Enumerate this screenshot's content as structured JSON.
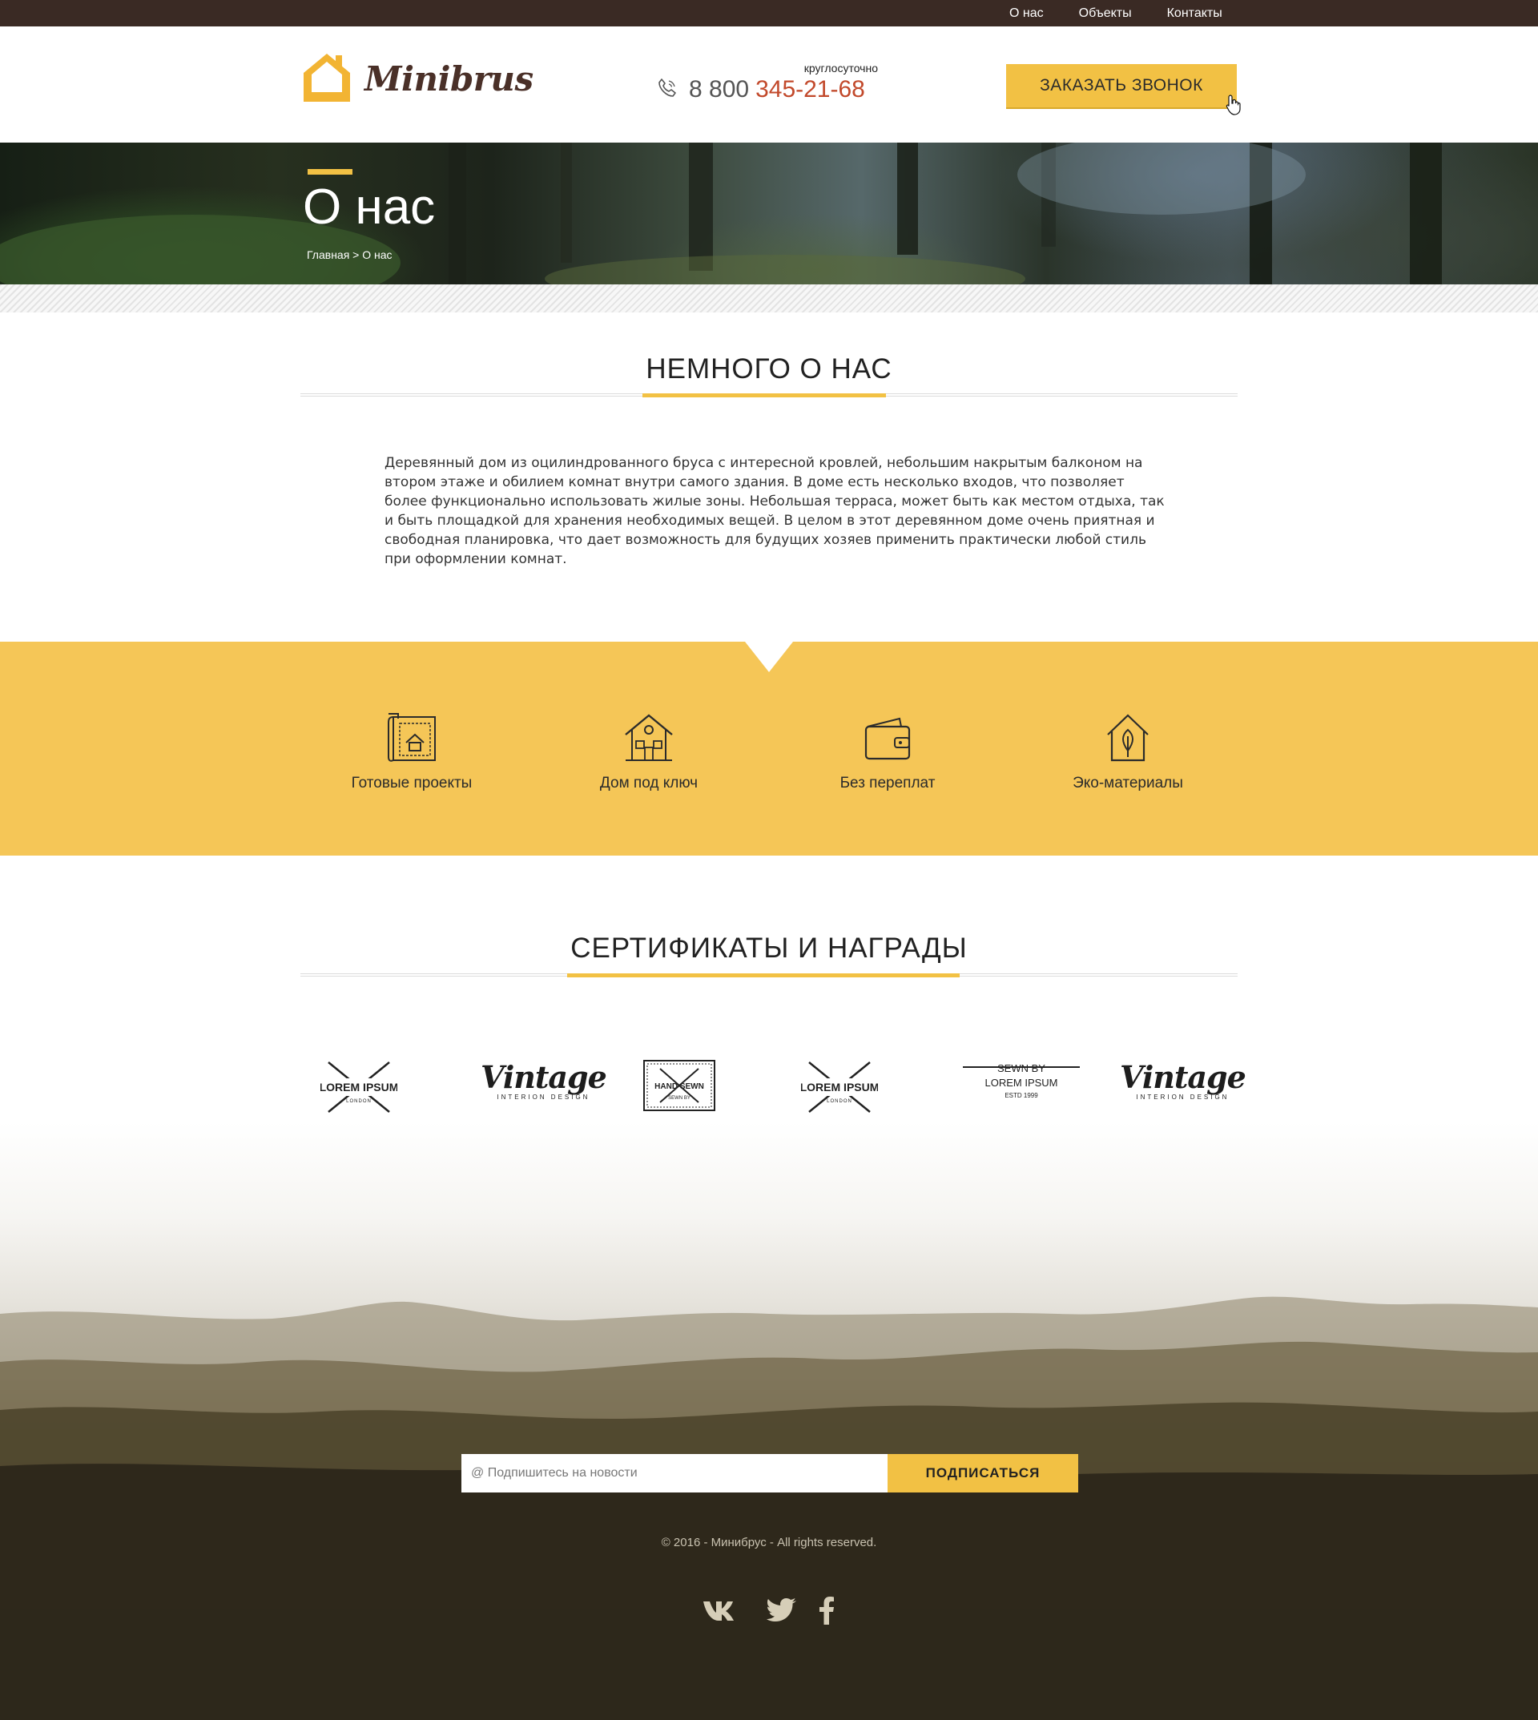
{
  "topnav": {
    "items": [
      "О нас",
      "Объекты",
      "Контакты"
    ]
  },
  "header": {
    "logo_text": "Minibrus",
    "phone_note": "круглосуточно",
    "phone_prefix": "8 800",
    "phone_number": "345-21-68",
    "call_button": "ЗАКАЗАТЬ ЗВОНОК"
  },
  "hero": {
    "title": "О нас",
    "breadcrumb": "Главная > О нас"
  },
  "about": {
    "title": "НЕМНОГО О НАС",
    "text": "Деревянный дом из оцилиндрованного бруса с интересной кровлей, небольшим накрытым балконом на втором этаже и обилием комнат внутри самого здания. В доме есть несколько входов, что позволяет более функционально использовать жилые зоны. Небольшая терраса, может быть как местом отдыха, так и быть площадкой для хранения необходимых вещей. В целом в этот деревянном доме очень приятная и свободная планировка, что дает возможность для будущих хозяев применить практически любой стиль при оформлении комнат."
  },
  "features": [
    {
      "label": "Готовые проекты",
      "icon": "blueprint-icon"
    },
    {
      "label": "Дом под ключ",
      "icon": "house-icon"
    },
    {
      "label": "Без переплат",
      "icon": "wallet-icon"
    },
    {
      "label": "Эко-материалы",
      "icon": "eco-house-icon"
    }
  ],
  "certificates": {
    "title": "СЕРТИФИКАТЫ И НАГРАДЫ",
    "logos": [
      {
        "big": "LOREM IPSUM",
        "small": "LONDON"
      },
      {
        "big": "Vintage",
        "small": "INTERION DESIGN"
      },
      {
        "big": "HAND SEWN",
        "small": "SEWN BY"
      },
      {
        "big": "LOREM IPSUM",
        "small": "LONDON"
      },
      {
        "big": "SEWN BY",
        "small": "LOREM IPSUM",
        "extra": "ESTD 1999"
      },
      {
        "big": "Vintage",
        "small": "INTERION DESIGN"
      }
    ]
  },
  "subscribe": {
    "placeholder": "@ Подпишитесь на новости",
    "button": "ПОДПИСАТЬСЯ"
  },
  "footer": {
    "copyright": "© 2016 - Минибрус - All rights reserved.",
    "social": [
      "vk-icon",
      "twitter-icon",
      "facebook-icon"
    ]
  },
  "colors": {
    "accent": "#f2c144",
    "topbar": "#3a2a24",
    "phone": "#c2492b",
    "features_bg": "#f5c657"
  }
}
